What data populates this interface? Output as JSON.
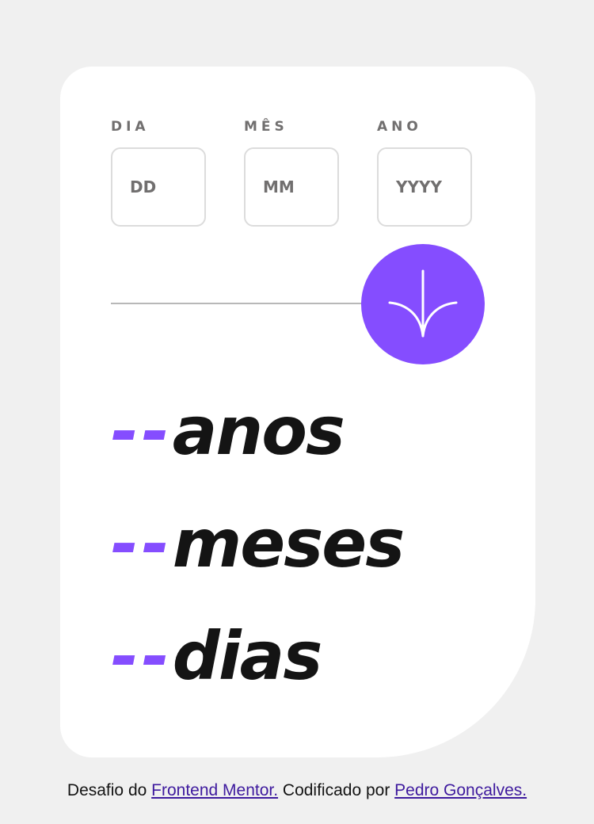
{
  "form": {
    "day": {
      "label": "DIA",
      "placeholder": "DD"
    },
    "month": {
      "label": "MÊS",
      "placeholder": "MM"
    },
    "year": {
      "label": "ANO",
      "placeholder": "YYYY"
    }
  },
  "submit": {
    "icon": "arrow-down-icon"
  },
  "results": {
    "years": {
      "value": "--",
      "unit": "anos"
    },
    "months": {
      "value": "--",
      "unit": "meses"
    },
    "days": {
      "value": "--",
      "unit": "dias"
    }
  },
  "attribution": {
    "prefix": "Desafio do ",
    "link1": "Frontend Mentor.",
    "middle": " Codificado por ",
    "link2": "Pedro Gonçalves."
  },
  "colors": {
    "accent": "#854dff",
    "background": "#f0f0f0",
    "card": "#ffffff",
    "label": "#716f6f",
    "text": "#141414",
    "link": "#3e1a9e"
  }
}
